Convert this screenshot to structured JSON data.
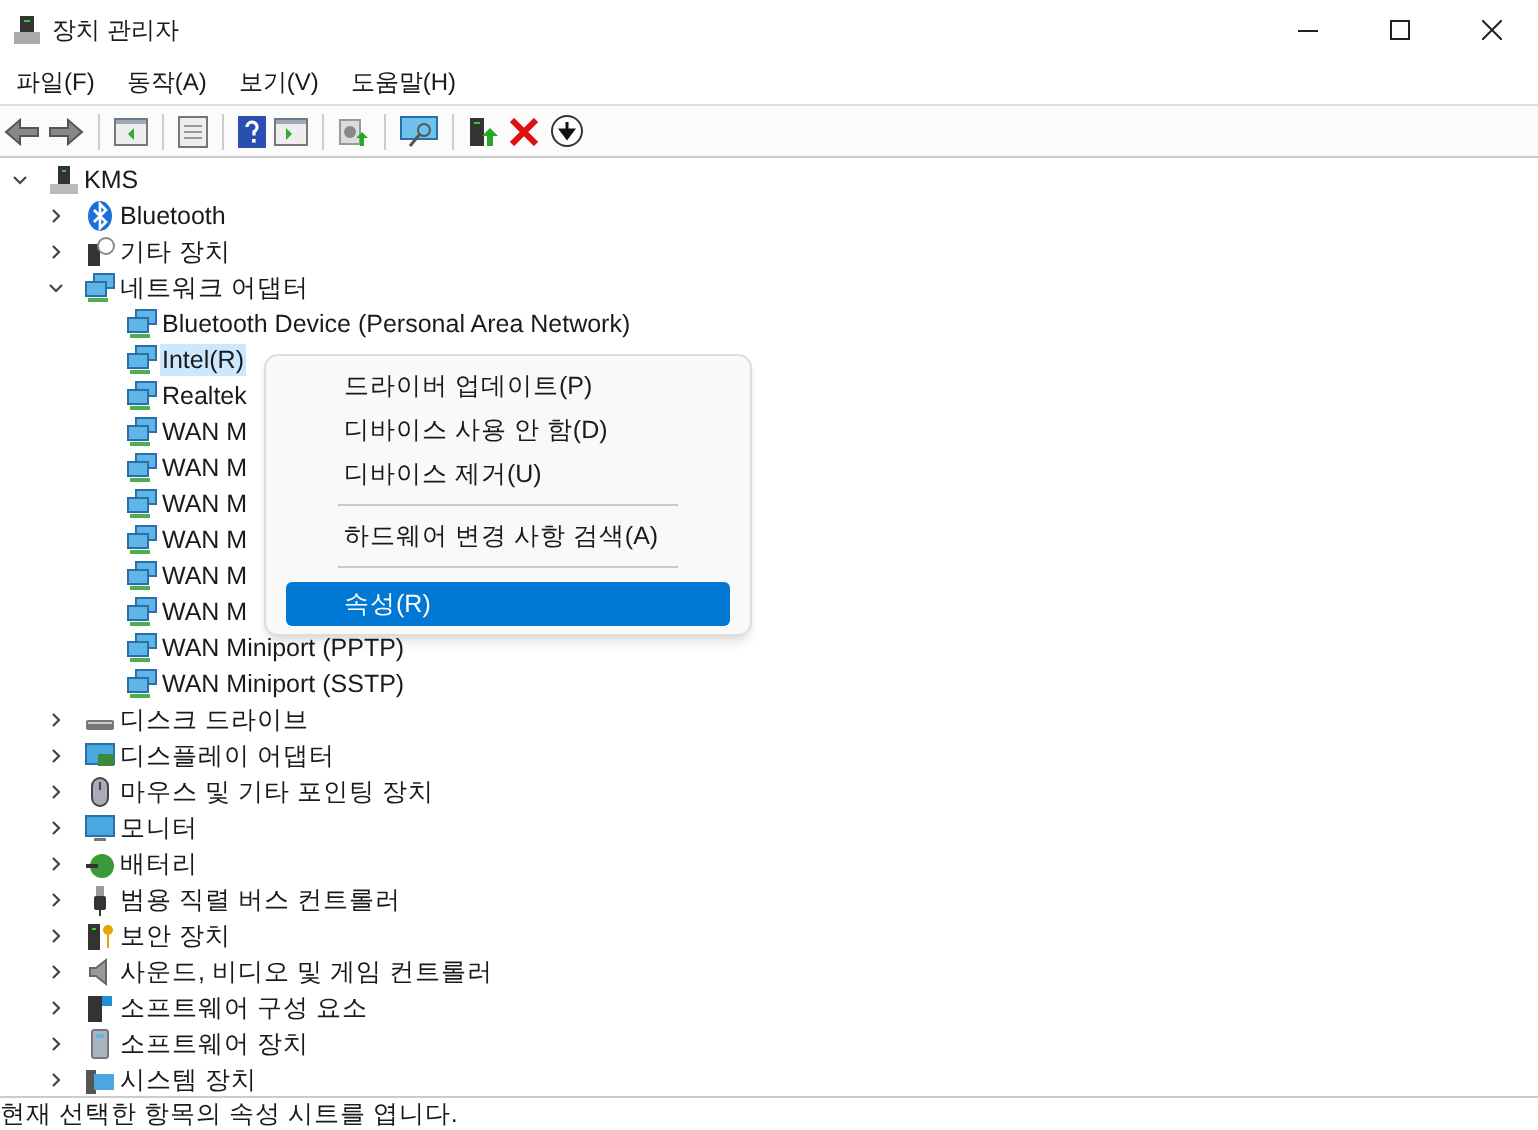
{
  "window": {
    "title": "장치 관리자"
  },
  "menu": [
    "파일(F)",
    "동작(A)",
    "보기(V)",
    "도움말(H)"
  ],
  "tree": {
    "label": "KMS",
    "kind": "computer",
    "expanded": true,
    "selected": false,
    "children": [
      {
        "label": "Bluetooth",
        "kind": "bluetooth",
        "expanded": false,
        "selected": false
      },
      {
        "label": "기타 장치",
        "kind": "other",
        "expanded": false,
        "selected": false
      },
      {
        "label": "네트워크 어댑터",
        "kind": "network",
        "expanded": true,
        "selected": false,
        "children": [
          {
            "label": "Bluetooth Device (Personal Area Network)",
            "kind": "network",
            "selected": false
          },
          {
            "label": "Intel(R)",
            "kind": "network",
            "selected": true
          },
          {
            "label": "Realtek",
            "kind": "network",
            "selected": false
          },
          {
            "label": "WAN M",
            "kind": "network",
            "selected": false
          },
          {
            "label": "WAN M",
            "kind": "network",
            "selected": false
          },
          {
            "label": "WAN M",
            "kind": "network",
            "selected": false
          },
          {
            "label": "WAN M",
            "kind": "network",
            "selected": false
          },
          {
            "label": "WAN M",
            "kind": "network",
            "selected": false
          },
          {
            "label": "WAN M",
            "kind": "network",
            "selected": false
          },
          {
            "label": "WAN Miniport (PPTP)",
            "kind": "network",
            "selected": false
          },
          {
            "label": "WAN Miniport (SSTP)",
            "kind": "network",
            "selected": false
          }
        ]
      },
      {
        "label": "디스크 드라이브",
        "kind": "disk",
        "expanded": false,
        "selected": false
      },
      {
        "label": "디스플레이 어댑터",
        "kind": "display",
        "expanded": false,
        "selected": false
      },
      {
        "label": "마우스 및 기타 포인팅 장치",
        "kind": "mouse",
        "expanded": false,
        "selected": false
      },
      {
        "label": "모니터",
        "kind": "monitor",
        "expanded": false,
        "selected": false
      },
      {
        "label": "배터리",
        "kind": "battery",
        "expanded": false,
        "selected": false
      },
      {
        "label": "범용 직렬 버스 컨트롤러",
        "kind": "usb",
        "expanded": false,
        "selected": false
      },
      {
        "label": "보안 장치",
        "kind": "security",
        "expanded": false,
        "selected": false
      },
      {
        "label": "사운드, 비디오 및 게임 컨트롤러",
        "kind": "sound",
        "expanded": false,
        "selected": false
      },
      {
        "label": "소프트웨어 구성 요소",
        "kind": "component",
        "expanded": false,
        "selected": false
      },
      {
        "label": "소프트웨어 장치",
        "kind": "softdevice",
        "expanded": false,
        "selected": false
      },
      {
        "label": "시스템 장치",
        "kind": "system",
        "expanded": false,
        "selected": false
      }
    ]
  },
  "context_menu": [
    {
      "kind": "item",
      "label": "드라이버 업데이트(P)",
      "selected": false
    },
    {
      "kind": "item",
      "label": "디바이스 사용 안 함(D)",
      "selected": false
    },
    {
      "kind": "item",
      "label": "디바이스 제거(U)",
      "selected": false
    },
    {
      "kind": "separator"
    },
    {
      "kind": "item",
      "label": "하드웨어 변경 사항 검색(A)",
      "selected": false
    },
    {
      "kind": "separator"
    },
    {
      "kind": "item",
      "label": "속성(R)",
      "selected": true
    }
  ],
  "status_bar": "현재 선택한 항목의 속성 시트를 엽니다."
}
